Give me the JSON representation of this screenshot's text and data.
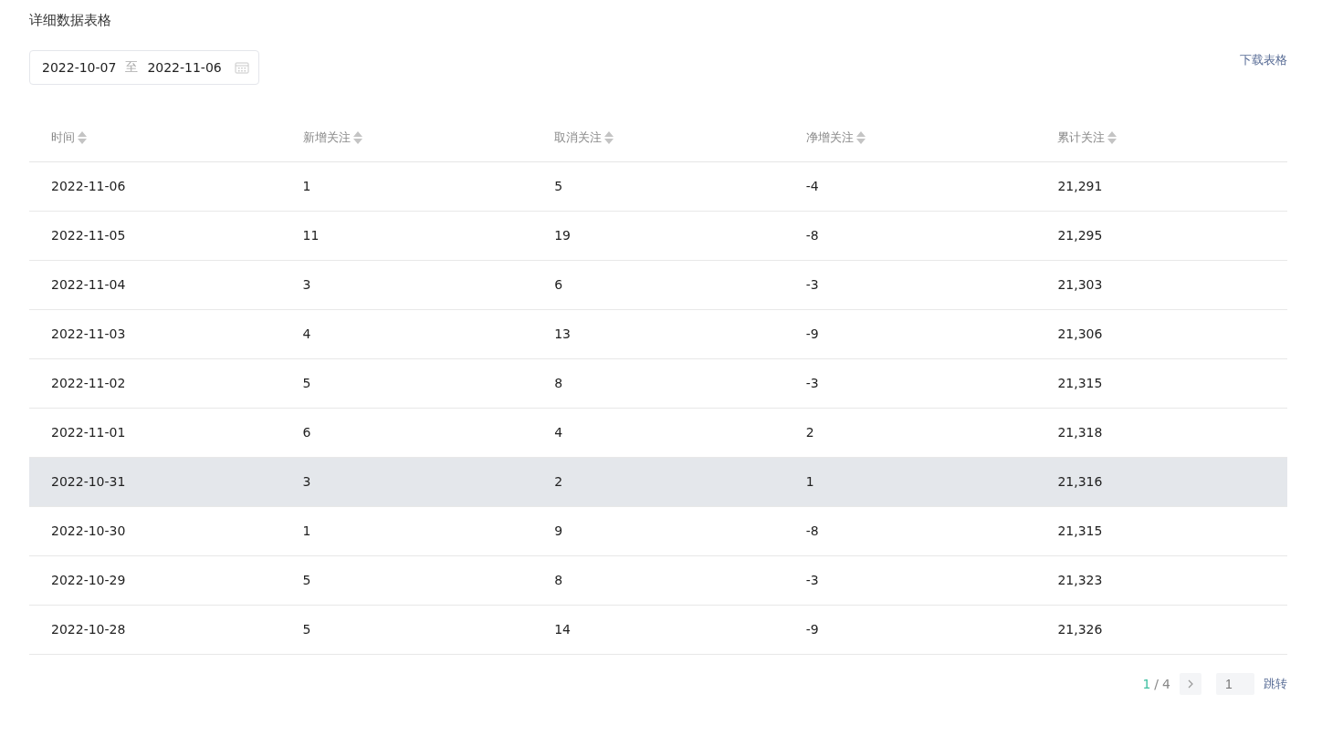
{
  "title": "详细数据表格",
  "date_range": {
    "start": "2022-10-07",
    "separator": "至",
    "end": "2022-11-06"
  },
  "download_link": "下载表格",
  "table": {
    "columns": [
      "时间",
      "新增关注",
      "取消关注",
      "净增关注",
      "累计关注"
    ],
    "rows": [
      {
        "cells": [
          "2022-11-06",
          "1",
          "5",
          "-4",
          "21,291"
        ],
        "selected": false
      },
      {
        "cells": [
          "2022-11-05",
          "11",
          "19",
          "-8",
          "21,295"
        ],
        "selected": false
      },
      {
        "cells": [
          "2022-11-04",
          "3",
          "6",
          "-3",
          "21,303"
        ],
        "selected": false
      },
      {
        "cells": [
          "2022-11-03",
          "4",
          "13",
          "-9",
          "21,306"
        ],
        "selected": false
      },
      {
        "cells": [
          "2022-11-02",
          "5",
          "8",
          "-3",
          "21,315"
        ],
        "selected": false
      },
      {
        "cells": [
          "2022-11-01",
          "6",
          "4",
          "2",
          "21,318"
        ],
        "selected": false
      },
      {
        "cells": [
          "2022-10-31",
          "3",
          "2",
          "1",
          "21,316"
        ],
        "selected": true
      },
      {
        "cells": [
          "2022-10-30",
          "1",
          "9",
          "-8",
          "21,315"
        ],
        "selected": false
      },
      {
        "cells": [
          "2022-10-29",
          "5",
          "8",
          "-3",
          "21,323"
        ],
        "selected": false
      },
      {
        "cells": [
          "2022-10-28",
          "5",
          "14",
          "-9",
          "21,326"
        ],
        "selected": false
      }
    ]
  },
  "pagination": {
    "current": "1",
    "separator": "/",
    "total": "4",
    "page_input": {
      "placeholder": "1"
    },
    "jump_button": "跳转"
  }
}
